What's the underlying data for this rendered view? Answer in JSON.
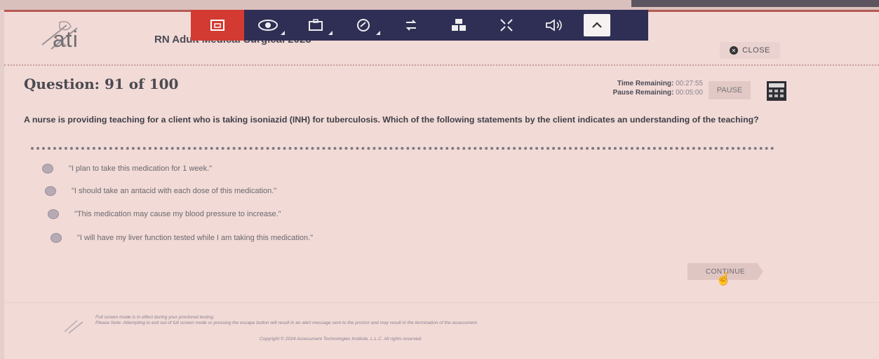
{
  "header": {
    "logo_text": "ati",
    "exam_title": "RN Adult Medical Surgical 2023",
    "close_label": "CLOSE"
  },
  "toolbar": {
    "buttons": [
      {
        "icon": "flag-icon",
        "active": true
      },
      {
        "icon": "eye-icon"
      },
      {
        "icon": "briefcase-icon"
      },
      {
        "icon": "highlighter-icon"
      },
      {
        "icon": "strikethrough-icon"
      },
      {
        "icon": "lab-values-icon"
      },
      {
        "icon": "expand-icon"
      },
      {
        "icon": "speaker-icon"
      }
    ],
    "collapse_icon": "chevron-up-icon"
  },
  "question": {
    "number_label": "Question: 91 of 100",
    "stem": "A nurse is providing teaching for a client who is taking isoniazid (INH) for tuberculosis. Which of the following statements by the client indicates an understanding of the teaching?",
    "options": [
      "\"I plan to take this medication for 1 week.\"",
      "\"I should take an antacid with each dose of this medication.\"",
      "\"This medication may cause my blood pressure to increase.\"",
      "\"I will have my liver function tested while I am taking this medication.\""
    ]
  },
  "timers": {
    "time_label": "Time Remaining:",
    "time_value": "00:27:55",
    "pause_label": "Pause Remaining:",
    "pause_value": "00:05:00"
  },
  "actions": {
    "pause_label": "PAUSE",
    "continue_label": "CONTINUE"
  },
  "footer": {
    "notice_line1": "Full screen mode is in effect during your proctored testing.",
    "notice_line2": "Please Note: Attempting to exit out of full screen mode or pressing the escape button will result in an alert message sent to the proctor and may result in the termination of the assessment.",
    "copyright": "Copyright © 2024 Assessment Technologies Institute, L.L.C. All rights reserved."
  },
  "colors": {
    "toolbar_bg": "#2f2f55",
    "active_tool": "#d23a32",
    "page_bg": "#f2dad6"
  }
}
